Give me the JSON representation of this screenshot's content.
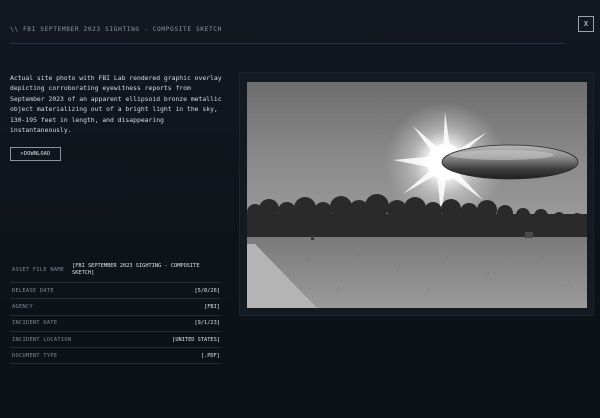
{
  "header": {
    "title": "\\\\ FBI SEPTEMBER 2023 SIGHTING - COMPOSITE SKETCH",
    "close_label": "X"
  },
  "description": "Actual site photo with FBI Lab rendered graphic overlay depicting corroborating eyewitness reports from September 2023 of an apparent ellipsoid bronze metallic object materializing out of a bright light in the sky, 130-195 feet in length, and disappearing instantaneously.",
  "download_label": ">DOWNLOAD",
  "metadata": {
    "asset_file_name": {
      "key": "ASSET FILE NAME",
      "value": "[FBI SEPTEMBER 2023 SIGHTING - COMPOSITE SKETCH]"
    },
    "release_date": {
      "key": "RELEASE DATE",
      "value": "[5/8/26]"
    },
    "agency": {
      "key": "AGENCY",
      "value": "[FBI]"
    },
    "incident_date": {
      "key": "INCIDENT DATE",
      "value": "[9/1/23]"
    },
    "incident_location": {
      "key": "INCIDENT LOCATION",
      "value": "[UNITED STATES]"
    },
    "document_type": {
      "key": "DOCUMENT TYPE",
      "value": "[.PDF]"
    }
  },
  "colors": {
    "background": "#0f141c",
    "panel": "#141a22",
    "text": "#d6dbe1",
    "muted": "#7f8894",
    "rule": "#2a323d"
  }
}
